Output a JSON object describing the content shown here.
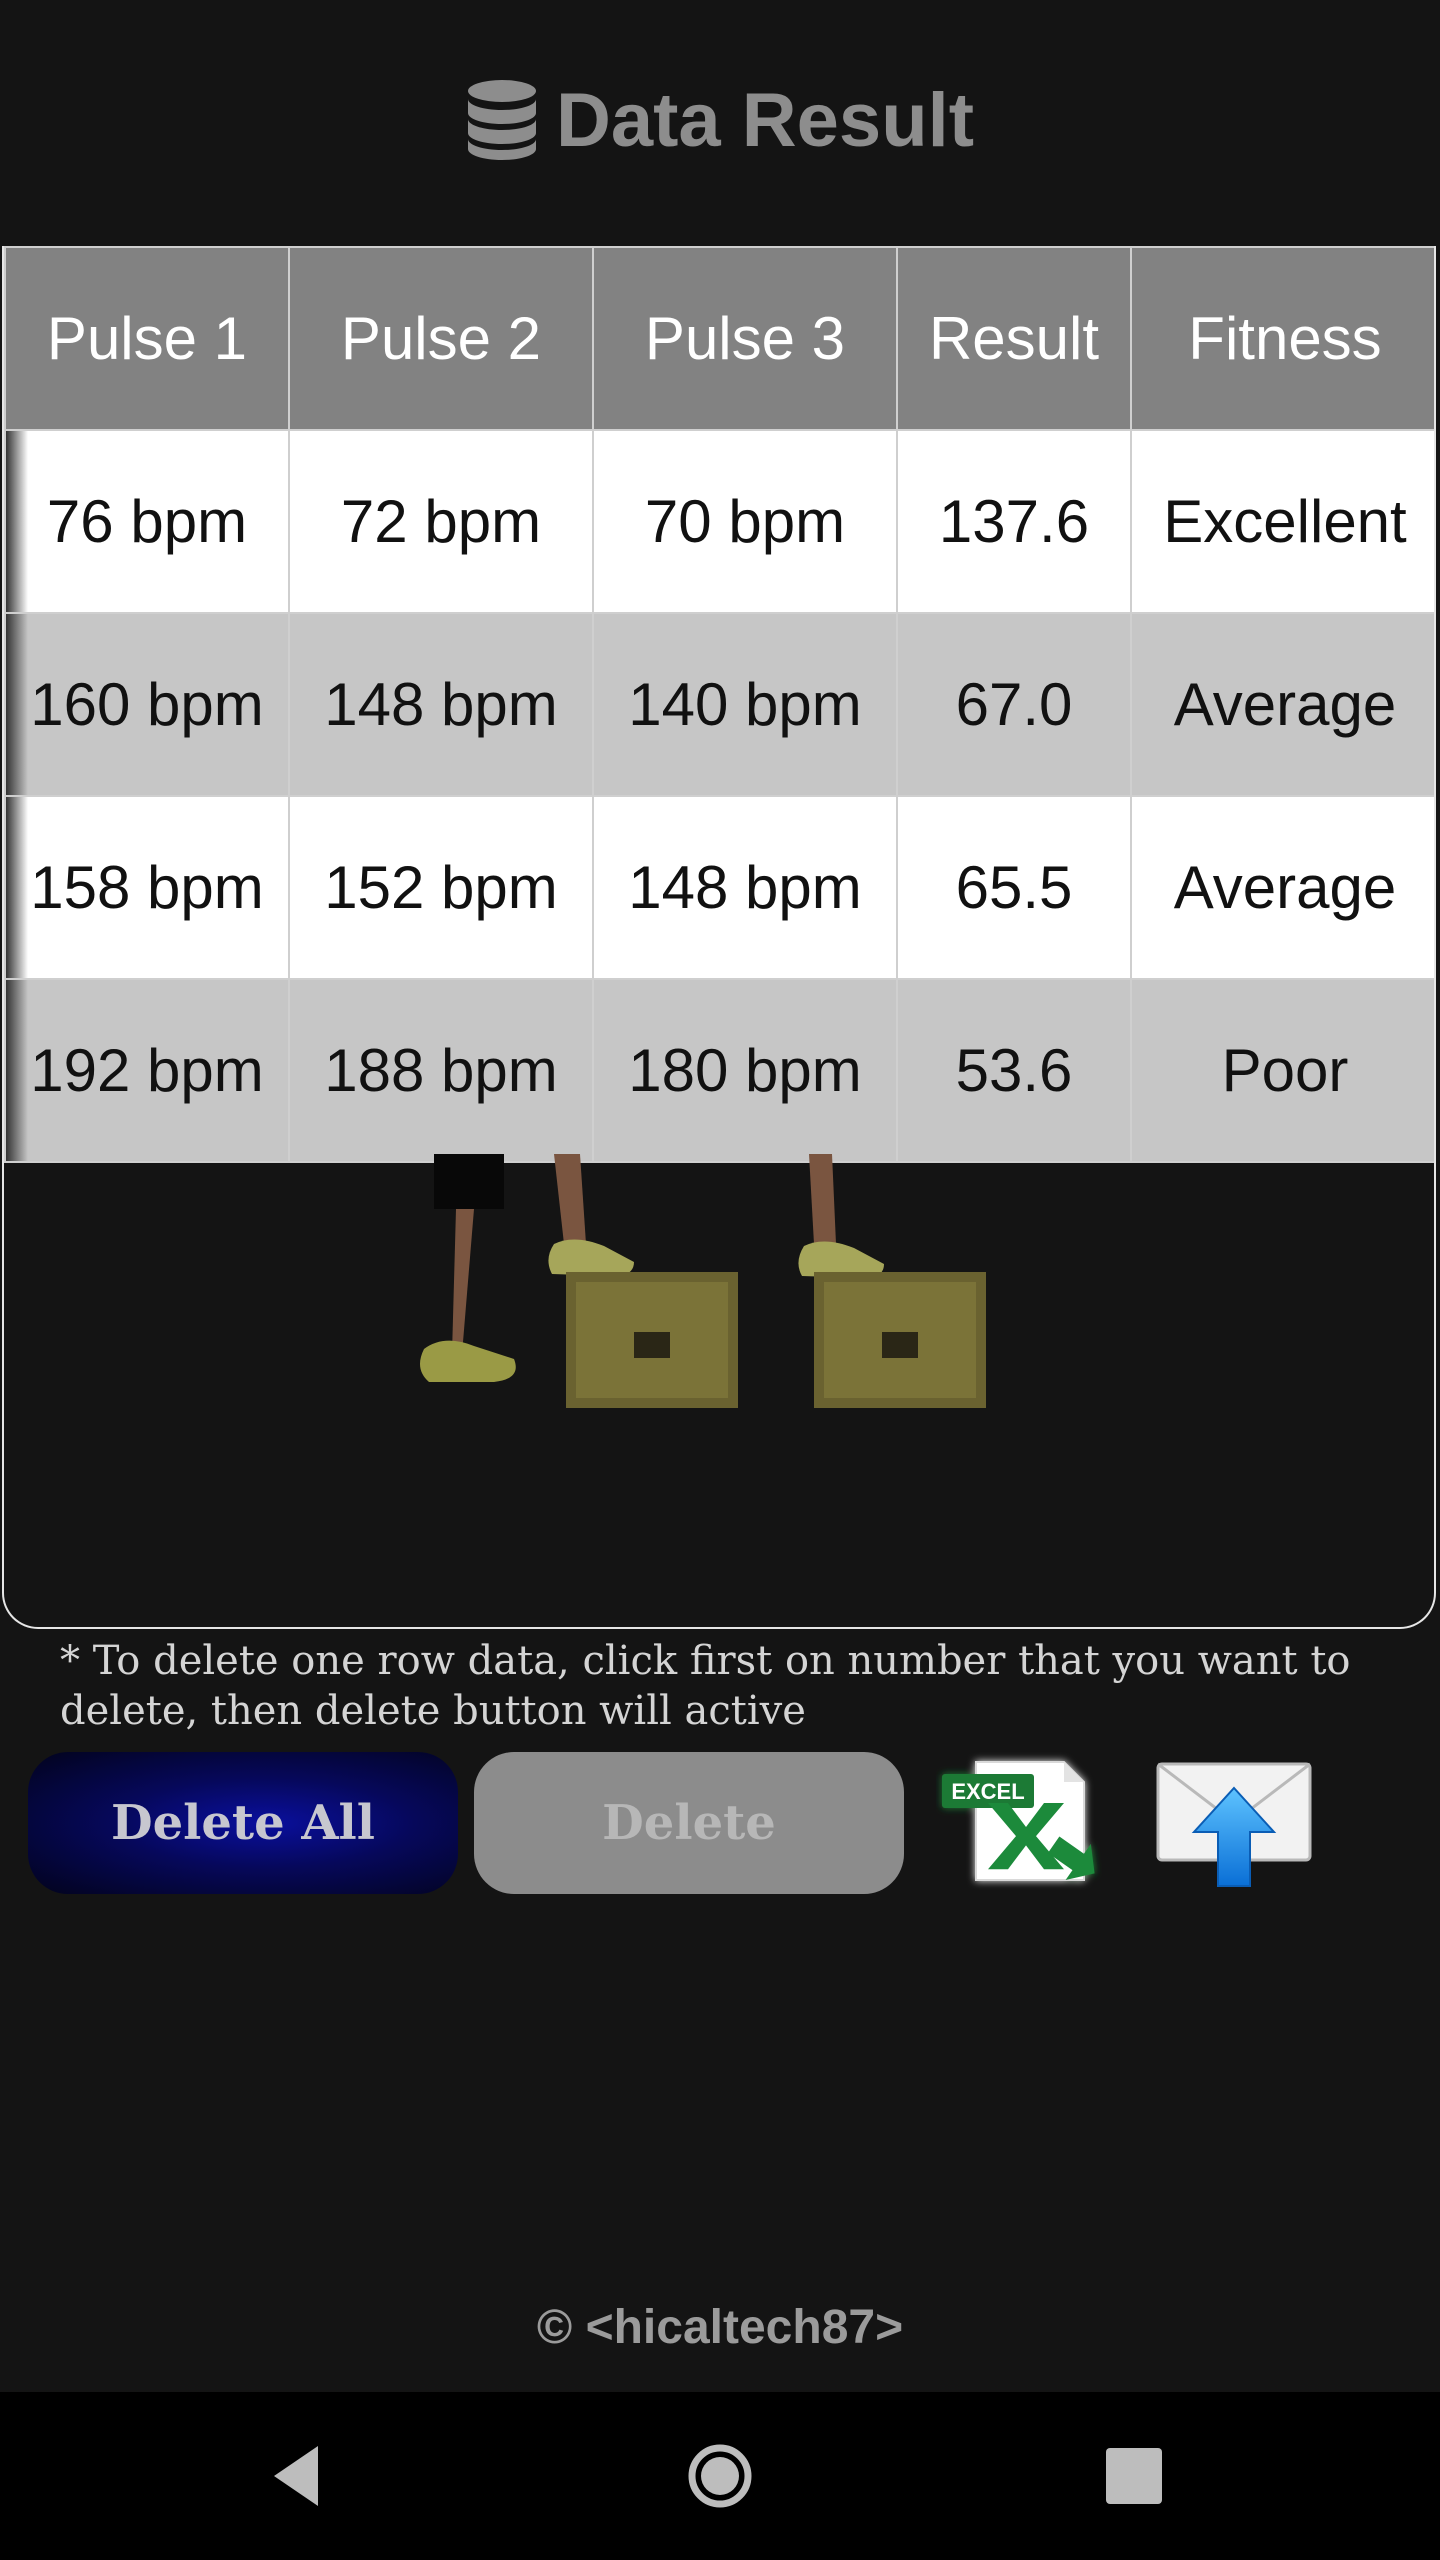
{
  "header": {
    "title": "Data Result",
    "icon": "database-icon"
  },
  "table": {
    "columns": [
      "Pulse 1",
      "Pulse 2",
      "Pulse 3",
      "Result",
      "Fitness"
    ],
    "rows": [
      [
        "76 bpm",
        "72 bpm",
        "70 bpm",
        "137.6",
        "Excellent"
      ],
      [
        "160 bpm",
        "148 bpm",
        "140 bpm",
        "67.0",
        "Average"
      ],
      [
        "158 bpm",
        "152 bpm",
        "148 bpm",
        "65.5",
        "Average"
      ],
      [
        "192 bpm",
        "188 bpm",
        "180 bpm",
        "53.6",
        "Poor"
      ]
    ]
  },
  "illustration": {
    "icon": "step-test-illustration"
  },
  "note": "* To delete one row data, click first on number that you want to delete, then delete button will active",
  "buttons": {
    "delete_all": "Delete All",
    "delete": "Delete",
    "excel_icon": "excel-export-icon",
    "excel_label": "EXCEL",
    "mail_icon": "email-send-icon"
  },
  "footer": {
    "copyright": "© <hicaltech87>"
  },
  "navbar": {
    "back_icon": "back-icon",
    "home_icon": "home-icon",
    "recents_icon": "recents-icon"
  },
  "colors": {
    "background": "#141414",
    "header_cell": "#828282",
    "row_alt": "#c6c6c6",
    "delete_all_bg": "#06085a",
    "delete_disabled_bg": "#8c8c8c"
  }
}
